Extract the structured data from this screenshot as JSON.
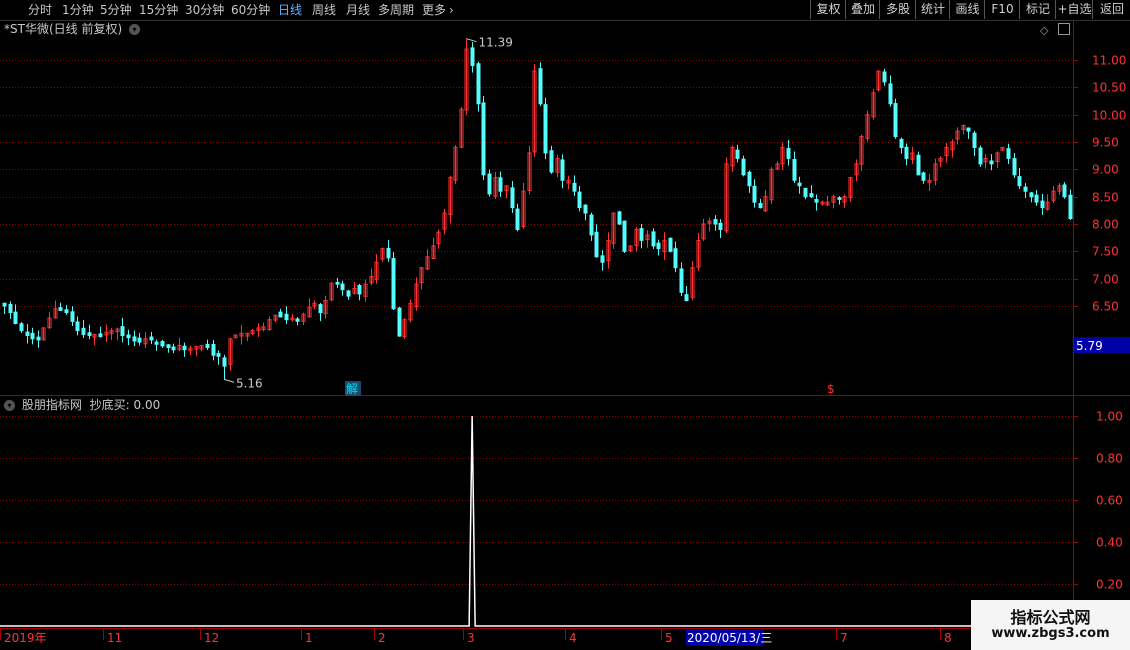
{
  "toolbar": {
    "periods": [
      "分时",
      "1分钟",
      "5分钟",
      "15分钟",
      "30分钟",
      "60分钟",
      "日线",
      "周线",
      "月线",
      "多周期",
      "更多"
    ],
    "active_period": "日线",
    "more_arrow": "›",
    "right_buttons": [
      "复权",
      "叠加",
      "多股",
      "统计",
      "画线",
      "F10",
      "标记",
      "+自选",
      "返回"
    ]
  },
  "main_panel": {
    "title": "*ST华微(日线 前复权)",
    "dropdown_icon": "circle-chevron-down-icon",
    "high_label": "11.39",
    "low_label": "5.16",
    "current_price_label": "5.79",
    "marker_jie": "解",
    "marker_s": "$"
  },
  "indicator_panel": {
    "title": "股朋指标网",
    "indicator_name": "抄底买:",
    "indicator_value": "0.00"
  },
  "date_axis": {
    "labels": [
      "2019年",
      "11",
      "12",
      "1",
      "2",
      "3",
      "4",
      "5",
      "2020/05/13/三",
      "7",
      "8"
    ],
    "highlight": "2020/05/13/三"
  },
  "watermark": {
    "line1": "指标公式网",
    "line2": "www.zbgs3.com"
  },
  "colors": {
    "up": "#ff3232",
    "down": "#54fcfc",
    "grid": "#8b0000",
    "axis_text": "#ff3232",
    "indicator_line": "#ffffff",
    "price_badge": "#0000a8"
  },
  "chart_data": [
    {
      "type": "candlestick",
      "title": "*ST华微(日线 前复权)",
      "y_ticks": [
        6.5,
        7.0,
        7.5,
        8.0,
        8.5,
        9.0,
        9.5,
        10.0,
        10.5,
        11.0
      ],
      "ylim": [
        5.0,
        11.6
      ],
      "grid": true,
      "annotations": {
        "high": 11.39,
        "low": 5.16,
        "last": 5.79
      },
      "close_series": [
        6.5,
        6.38,
        6.18,
        6.05,
        5.96,
        5.9,
        5.88,
        6.1,
        6.28,
        6.45,
        6.42,
        6.38,
        6.22,
        6.05,
        5.98,
        5.96,
        5.98,
        5.94,
        6.02,
        6.05,
        6.08,
        5.96,
        5.92,
        5.86,
        5.84,
        5.9,
        5.88,
        5.8,
        5.77,
        5.74,
        5.7,
        5.78,
        5.7,
        5.73,
        5.76,
        5.78,
        5.74,
        5.6,
        5.58,
        5.4,
        5.9,
        5.97,
        6.0,
        6.0,
        6.05,
        6.1,
        6.12,
        6.25,
        6.33,
        6.3,
        6.25,
        6.28,
        6.22,
        6.35,
        6.48,
        6.55,
        6.38,
        6.6,
        6.92,
        6.9,
        6.8,
        6.68,
        6.82,
        6.72,
        6.9,
        7.04,
        7.3,
        7.55,
        7.38,
        6.45,
        5.95,
        6.25,
        6.55,
        6.9,
        7.2,
        7.4,
        7.6,
        7.85,
        8.2,
        8.85,
        9.4,
        10.1,
        11.2,
        10.9,
        10.2,
        8.9,
        8.55,
        8.85,
        8.6,
        8.7,
        8.3,
        7.9,
        8.6,
        9.3,
        10.8,
        10.2,
        9.3,
        8.95,
        9.2,
        8.8,
        8.8,
        8.6,
        8.3,
        8.2,
        7.8,
        7.4,
        7.3,
        7.7,
        8.2,
        8.0,
        7.5,
        7.6,
        7.9,
        7.7,
        7.8,
        7.6,
        7.55,
        7.7,
        7.5,
        7.2,
        6.75,
        6.6,
        7.2,
        7.7,
        8.0,
        8.05,
        8.0,
        7.9,
        9.1,
        9.4,
        9.2,
        8.9,
        8.7,
        8.4,
        8.3,
        8.5,
        9.0,
        9.1,
        9.4,
        9.2,
        8.8,
        8.7,
        8.5,
        8.5,
        8.4,
        8.4,
        8.4,
        8.5,
        8.45,
        8.5,
        8.85,
        9.1,
        9.6,
        10.0,
        10.4,
        10.8,
        10.6,
        10.2,
        9.6,
        9.4,
        9.2,
        9.3,
        8.9,
        8.8,
        8.8,
        9.1,
        9.2,
        9.4,
        9.5,
        9.7,
        9.8,
        9.7,
        9.4,
        9.1,
        9.2,
        9.1,
        9.3,
        9.4,
        9.2,
        8.9,
        8.7,
        8.6,
        8.5,
        8.4,
        8.3,
        8.4,
        8.6,
        8.7,
        8.5,
        8.1
      ]
    },
    {
      "type": "line",
      "title": "股朋指标网",
      "series_name": "抄底买",
      "y_ticks": [
        0.2,
        0.4,
        0.6,
        0.8,
        1.0
      ],
      "ylim": [
        0,
        1.05
      ],
      "signal_index": 83,
      "signal_value": 1.0,
      "last_value": 0.0,
      "grid": true
    }
  ]
}
